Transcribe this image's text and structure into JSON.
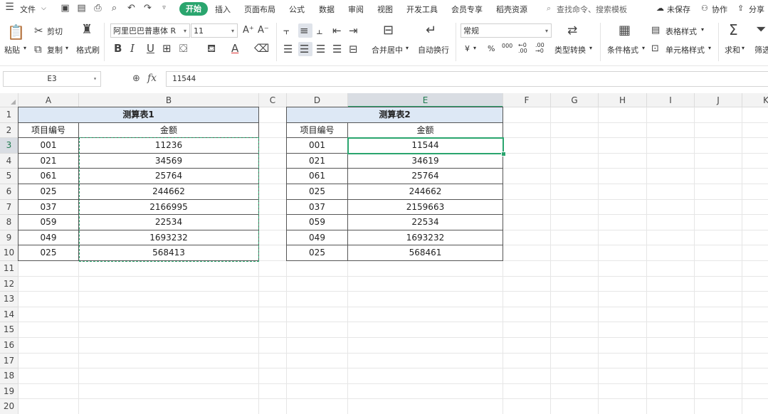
{
  "menu": {
    "file": "文件",
    "tabs": [
      "开始",
      "插入",
      "页面布局",
      "公式",
      "数据",
      "审阅",
      "视图",
      "开发工具",
      "会员专享",
      "稻壳资源"
    ],
    "search": "查找命令、搜索模板",
    "unsaved": "未保存",
    "collab": "协作",
    "share": "分享"
  },
  "ribbon": {
    "paste": "粘贴",
    "cut": "剪切",
    "copy": "复制",
    "format_painter": "格式刷",
    "font_name": "阿里巴巴普惠体 R",
    "font_size": "11",
    "merge_center": "合并居中",
    "wrap_text": "自动换行",
    "number_format": "常规",
    "type_convert": "类型转换",
    "conditional_format": "条件格式",
    "table_style": "表格样式",
    "cell_style": "单元格样式",
    "sum": "求和",
    "filter": "筛选",
    "currency_symbol": "¥",
    "percent_symbol": "%",
    "thousands": "000",
    "inc_decimal": "←0 .00",
    "dec_decimal": ".00 →0"
  },
  "formula_bar": {
    "name_box": "E3",
    "fx": "fx",
    "value": "11544"
  },
  "columns": [
    "A",
    "B",
    "C",
    "D",
    "E",
    "F",
    "G",
    "H",
    "I",
    "J",
    "K"
  ],
  "rows": [
    "1",
    "2",
    "3",
    "4",
    "5",
    "6",
    "7",
    "8",
    "9",
    "10",
    "11",
    "12",
    "13",
    "14",
    "15",
    "16",
    "17",
    "18",
    "19",
    "20"
  ],
  "table1": {
    "title": "测算表1",
    "headers": [
      "项目编号",
      "金额"
    ],
    "rows": [
      [
        "001",
        "11236"
      ],
      [
        "021",
        "34569"
      ],
      [
        "061",
        "25764"
      ],
      [
        "025",
        "244662"
      ],
      [
        "037",
        "2166995"
      ],
      [
        "059",
        "22534"
      ],
      [
        "049",
        "1693232"
      ],
      [
        "025",
        "568413"
      ]
    ]
  },
  "table2": {
    "title": "测算表2",
    "headers": [
      "项目编号",
      "金额"
    ],
    "rows": [
      [
        "001",
        "11544"
      ],
      [
        "021",
        "34619"
      ],
      [
        "061",
        "25764"
      ],
      [
        "025",
        "244662"
      ],
      [
        "037",
        "2159663"
      ],
      [
        "059",
        "22534"
      ],
      [
        "049",
        "1693232"
      ],
      [
        "025",
        "568461"
      ]
    ]
  },
  "colors": {
    "accent": "#2aa56e",
    "table_header_fill": "#dde8f5"
  }
}
